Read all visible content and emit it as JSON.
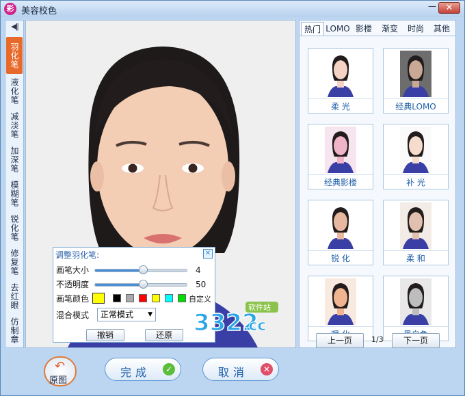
{
  "window": {
    "title": "美容校色",
    "icon_text": "彩",
    "minimize_glyph": "—",
    "close_glyph": "✕"
  },
  "tools": {
    "collapse_glyph": "◀||",
    "items": [
      {
        "label": "羽化笔",
        "active": true
      },
      {
        "label": "液化笔",
        "active": false
      },
      {
        "label": "减淡笔",
        "active": false
      },
      {
        "label": "加深笔",
        "active": false
      },
      {
        "label": "模糊笔",
        "active": false
      },
      {
        "label": "锐化笔",
        "active": false
      },
      {
        "label": "修复笔",
        "active": false
      },
      {
        "label": "去红眼",
        "active": false
      },
      {
        "label": "仿制章",
        "active": false
      }
    ]
  },
  "adjust_panel": {
    "title": "调整羽化笔:",
    "close_glyph": "✕",
    "brush_size": {
      "label": "画笔大小",
      "value": "4",
      "level": 0.52
    },
    "opacity": {
      "label": "不透明度",
      "value": "50",
      "level": 0.52
    },
    "brush_color": {
      "label": "画笔颜色",
      "selected": "#ffff00",
      "swatches": [
        "#000000",
        "#aaaaaa",
        "#ff0000",
        "#ffff00",
        "#00ffff",
        "#00dd00"
      ],
      "custom_label": "自定义"
    },
    "blend_mode": {
      "label": "混合模式",
      "value": "正常模式"
    },
    "undo_label": "撤销",
    "restore_label": "还原"
  },
  "watermark": {
    "brand": "3322",
    "suffix": ".cc",
    "tag": "软件站"
  },
  "actions": {
    "original_label": "原图",
    "done_label": "完成",
    "cancel_label": "取消"
  },
  "effects_panel": {
    "tabs": [
      {
        "label": "热门",
        "active": true
      },
      {
        "label": "LOMO",
        "active": false
      },
      {
        "label": "影楼",
        "active": false
      },
      {
        "label": "渐变",
        "active": false
      },
      {
        "label": "时尚",
        "active": false
      },
      {
        "label": "其他",
        "active": false
      }
    ],
    "thumbnails": [
      {
        "label": "柔 光",
        "tone": "#f4d2c4",
        "bg": "#ffffff"
      },
      {
        "label": "经典LOMO",
        "tone": "#caa896",
        "bg": "#6d6d6d"
      },
      {
        "label": "经典影楼",
        "tone": "#f0b4c8",
        "bg": "#f6e4ee"
      },
      {
        "label": "补 光",
        "tone": "#f6dccd",
        "bg": "#fafafa"
      },
      {
        "label": "锐 化",
        "tone": "#e8b79f",
        "bg": "#ffffff"
      },
      {
        "label": "柔 和",
        "tone": "#e2c0b0",
        "bg": "#f2ebe6"
      },
      {
        "label": "暖 化",
        "tone": "#f0b590",
        "bg": "#f8eadf"
      },
      {
        "label": "黑白色",
        "tone": "#bdbdbd",
        "bg": "#e8e8e8"
      }
    ],
    "prev_label": "上一页",
    "next_label": "下一页",
    "page_indicator": "1/3"
  }
}
